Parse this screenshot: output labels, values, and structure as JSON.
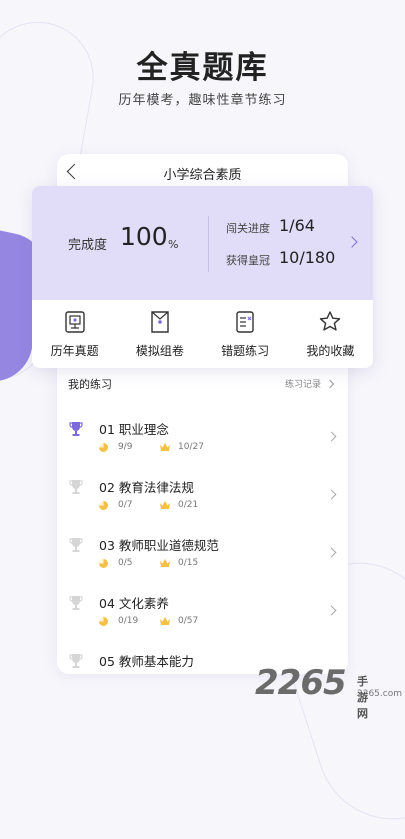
{
  "hero": {
    "title": "全真题库",
    "subtitle": "历年模考，趣味性章节练习"
  },
  "screen": {
    "title": "小学综合素质"
  },
  "stats": {
    "completion_label": "完成度",
    "completion_value": "100",
    "completion_unit": "%",
    "level_label": "闯关进度",
    "level_value": "1/64",
    "crown_label": "获得皇冠",
    "crown_value": "10/180"
  },
  "shortcuts": [
    {
      "label": "历年真题",
      "icon": "past-exam-icon"
    },
    {
      "label": "模拟组卷",
      "icon": "mock-paper-icon"
    },
    {
      "label": "错题练习",
      "icon": "wrong-question-icon"
    },
    {
      "label": "我的收藏",
      "icon": "star-icon"
    }
  ],
  "practice": {
    "title": "我的练习",
    "record_link": "练习记录",
    "items": [
      {
        "title": "01  职业理念",
        "done": "9/9",
        "crowns": "10/27",
        "active": true
      },
      {
        "title": "02  教育法律法规",
        "done": "0/7",
        "crowns": "0/21",
        "active": false
      },
      {
        "title": "03  教师职业道德规范",
        "done": "0/5",
        "crowns": "0/15",
        "active": false
      },
      {
        "title": "04  文化素养",
        "done": "0/19",
        "crowns": "0/57",
        "active": false
      },
      {
        "title": "05  教师基本能力",
        "done": "",
        "crowns": "",
        "active": false
      }
    ]
  },
  "colors": {
    "accent": "#7d6ad8",
    "card_bg": "#e1dcf7",
    "gold": "#f4c04a"
  },
  "watermark": {
    "number": "2265",
    "site": "手游网",
    "domain": "2265.com"
  }
}
